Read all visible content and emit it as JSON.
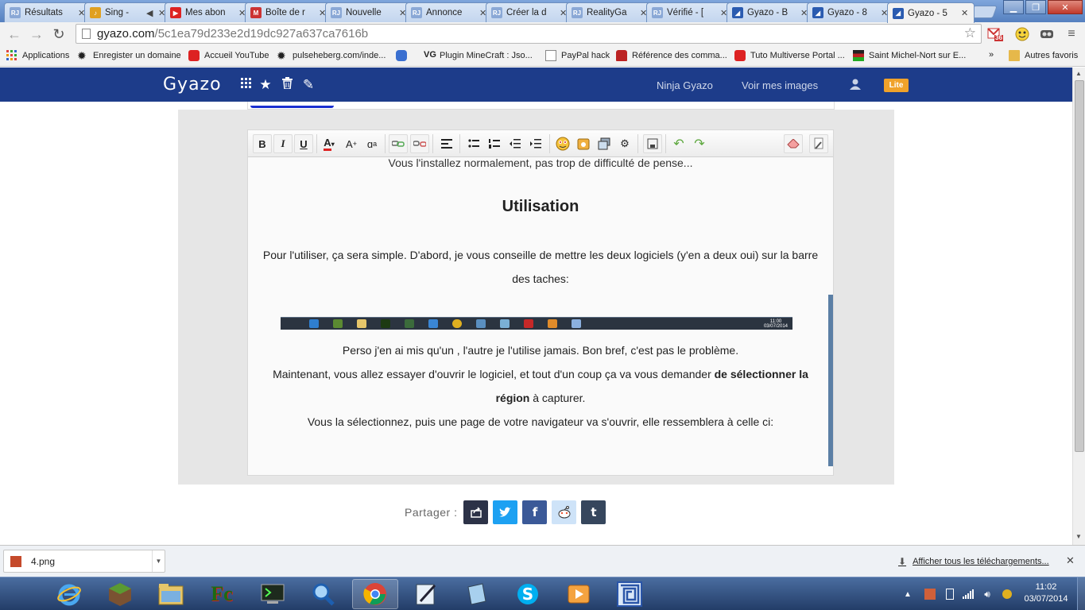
{
  "browser": {
    "tabs": [
      {
        "title": "Résultats",
        "icon": "rj-icon",
        "color": "#8aa8d6"
      },
      {
        "title": "Sing -",
        "icon": "music-icon",
        "color": "#e0a020"
      },
      {
        "title": "Mes abon",
        "icon": "youtube-icon",
        "color": "#d22"
      },
      {
        "title": "Boîte de r",
        "icon": "gmail-icon",
        "color": "#c33"
      },
      {
        "title": "Nouvelle",
        "icon": "rj-icon",
        "color": "#8aa8d6"
      },
      {
        "title": "Annonce",
        "icon": "rj-icon",
        "color": "#8aa8d6"
      },
      {
        "title": "Créer la d",
        "icon": "rj-icon",
        "color": "#8aa8d6"
      },
      {
        "title": "RealityGa",
        "icon": "rj-icon",
        "color": "#8aa8d6"
      },
      {
        "title": "Vérifié - [",
        "icon": "rj-icon",
        "color": "#8aa8d6"
      },
      {
        "title": "Gyazo - B",
        "icon": "gyazo-icon",
        "color": "#2a5bb0"
      },
      {
        "title": "Gyazo - 8",
        "icon": "gyazo-icon",
        "color": "#2a5bb0"
      },
      {
        "title": "Gyazo - 5",
        "icon": "gyazo-icon",
        "color": "#2a5bb0"
      }
    ],
    "url_host": "gyazo.com",
    "url_path": "/5c1ea79d233e2d19dc927a637ca7616b",
    "gmail_count": "36",
    "bookmarks": [
      {
        "label": "Applications",
        "icon": "apps-grid-icon"
      },
      {
        "label": "Enregister un domaine",
        "icon": "gear-icon"
      },
      {
        "label": "Accueil YouTube",
        "icon": "youtube-icon"
      },
      {
        "label": "pulseheberg.com/inde...",
        "icon": "gear-icon"
      },
      {
        "label": "",
        "icon": "gamepad-icon"
      },
      {
        "label": "Plugin MineCraft : Jso...",
        "icon": "vg-icon"
      },
      {
        "label": "PayPal hack",
        "icon": "page-icon"
      },
      {
        "label": "Référence des comma...",
        "icon": "bottle-icon"
      },
      {
        "label": "Tuto Multiverse Portal ...",
        "icon": "youtube-icon"
      },
      {
        "label": "Saint Michel-Nort sur E...",
        "icon": "flag-icon"
      }
    ],
    "bookmarks_more": "»",
    "other_bookmarks": "Autres favoris"
  },
  "gyazo": {
    "logo": "Gyazo",
    "nav_links": [
      "Ninja Gyazo",
      "Voir mes images"
    ],
    "lite_badge": "Lite",
    "share_label": "Partager :",
    "share_buttons": [
      {
        "name": "share-export-button",
        "glyph": "⇪",
        "color": "#2c3247"
      },
      {
        "name": "share-twitter-button",
        "glyph": "t",
        "color": "#1da1f2"
      },
      {
        "name": "share-facebook-button",
        "glyph": "f",
        "color": "#3b5998"
      },
      {
        "name": "share-reddit-button",
        "glyph": "☺",
        "color": "#cee3f8"
      },
      {
        "name": "share-tumblr-button",
        "glyph": "t",
        "color": "#36465d"
      }
    ]
  },
  "editor": {
    "cut_line": "Vous l'installez normalement, pas trop de difficulté de pense...",
    "heading": "Utilisation",
    "para1": "Pour l'utiliser, ça sera simple. D'abord, je vous conseille de mettre les deux logiciels (y'en a deux oui) sur la barre des taches:",
    "para2": "Perso j'en ai mis qu'un , l'autre je l'utilise jamais. Bon bref, c'est pas le problème.",
    "para3_a": "Maintenant, vous allez essayer d'ouvrir le logiciel, et tout d'un coup ça va vous demander ",
    "para3_bold": "de sélectionner la région",
    "para3_b": " à capturer.",
    "para4": "Vous la sélectionnez, puis une page de votre navigateur va s'ouvrir, elle ressemblera à celle ci:",
    "embedded_clock_time": "11:00",
    "embedded_clock_date": "03/07/2014"
  },
  "downloads": {
    "file_name": "4.png",
    "show_all": "Afficher tous les téléchargements..."
  },
  "taskbar": {
    "apps": [
      "internet-explorer-icon",
      "minecraft-icon",
      "file-explorer-icon",
      "fc-icon",
      "terminal-icon",
      "search-icon",
      "chrome-icon",
      "notepad-icon",
      "book-icon",
      "skype-icon",
      "media-player-icon",
      "maze-icon"
    ],
    "time": "11:02",
    "date": "03/07/2014"
  }
}
